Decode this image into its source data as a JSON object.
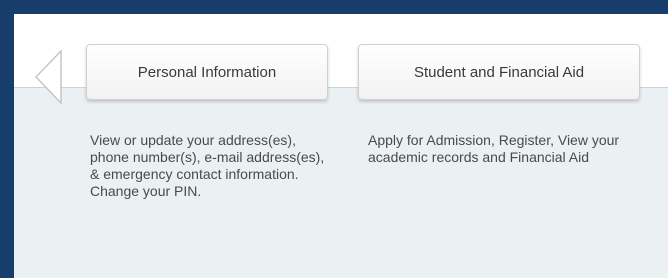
{
  "tabs": [
    {
      "label": "Personal Information",
      "description": "View or update your address(es), phone number(s), e-mail address(es), & emergency contact information. Change your PIN."
    },
    {
      "label": "Student and Financial Aid",
      "description": "Apply for Admission, Register, View your academic records and Financial Aid"
    }
  ],
  "icons": {
    "prev": "chevron-left-icon"
  },
  "colors": {
    "frame_border": "#173e6b",
    "panel_background": "#ebf0f3"
  }
}
